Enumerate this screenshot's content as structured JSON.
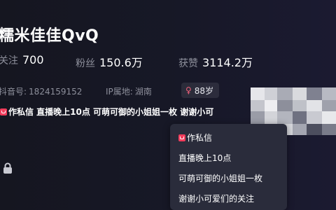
{
  "profile": {
    "name": "糯米佳佳QvQ",
    "stats": [
      {
        "label": "关注",
        "value": "700"
      },
      {
        "label": "粉丝",
        "value": "150.6万"
      },
      {
        "label": "获赞",
        "value": "3114.2万"
      }
    ],
    "douyin_id_label": "抖音号:",
    "douyin_id": "1824159152",
    "ip_label": "IP属地:",
    "ip_location": "湖南",
    "age": "88岁",
    "age_icon": "female-symbol-icon",
    "bio_preview": "作私信 直播晚上10点 可萌可御的小姐姐一枚 谢谢小可"
  },
  "tooltip": {
    "lines": [
      "作私信",
      "直播晚上10点",
      "可萌可御的小姐姐一枚",
      "谢谢小可爱们的关注"
    ]
  },
  "colors": {
    "background": "#161722",
    "muted_text": "#8d8f9b",
    "accent_red": "#f23d5c",
    "tooltip_bg": "#2a2c3b"
  }
}
